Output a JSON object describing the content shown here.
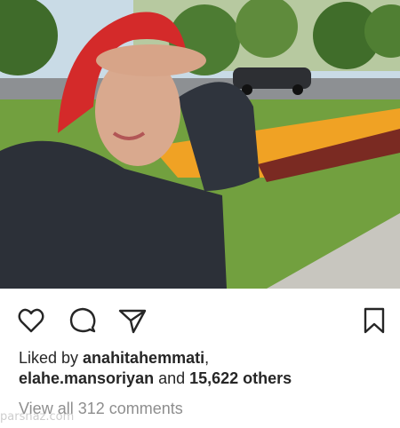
{
  "post": {
    "photo_alt": "selfie photo",
    "likes": {
      "prefix": "Liked by ",
      "user1": "anahitahemmati",
      "separator": ",",
      "user2": "elahe.mansoriyan",
      "middle": " and ",
      "count": "15,622 others"
    },
    "view_comments": "View all 312 comments"
  },
  "icons": {
    "like": "heart-outline-icon",
    "comment": "speech-bubble-icon",
    "share": "paper-plane-icon",
    "save": "bookmark-icon"
  },
  "watermark": "parsnaz.com",
  "colors": {
    "text": "#262626",
    "muted": "#8e8e8e",
    "background": "#ffffff"
  }
}
